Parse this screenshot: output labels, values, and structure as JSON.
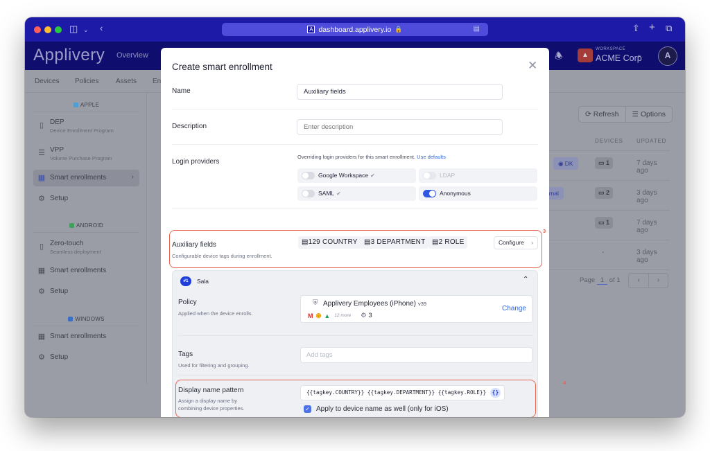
{
  "browser": {
    "url": "dashboard.applivery.io",
    "lock_icon": "lock-icon",
    "reader_icon": "reader-icon"
  },
  "header": {
    "brand": "Applivery",
    "nav": [
      "Overview"
    ],
    "workspace_label": "WORKSPACE",
    "workspace_name": "ACME Corp",
    "avatar_glyph": "A"
  },
  "subnav": [
    "Devices",
    "Policies",
    "Assets",
    "En"
  ],
  "sidebar": {
    "sections": [
      {
        "title": "APPLE",
        "color": "#4d9fd6",
        "items": [
          {
            "label": "DEP",
            "sub": "Device Enrollment Program",
            "icon": "phone-icon"
          },
          {
            "label": "VPP",
            "sub": "Volume Purchase Program",
            "icon": "layers-icon"
          },
          {
            "label": "Smart enrollments",
            "icon": "nodes-icon",
            "active": true
          },
          {
            "label": "Setup",
            "icon": "gear-icon"
          }
        ]
      },
      {
        "title": "ANDROID",
        "color": "#3fa05a",
        "items": [
          {
            "label": "Zero-touch",
            "sub": "Seamless deployment",
            "icon": "phone-icon"
          },
          {
            "label": "Smart enrollments",
            "icon": "nodes-icon"
          },
          {
            "label": "Setup",
            "icon": "gear-icon"
          }
        ]
      },
      {
        "title": "WINDOWS",
        "color": "#3a6fc7",
        "items": [
          {
            "label": "Smart enrollments",
            "icon": "nodes-icon"
          },
          {
            "label": "Setup",
            "icon": "gear-icon"
          }
        ]
      }
    ]
  },
  "background_table": {
    "refresh_label": "Refresh",
    "options_label": "Options",
    "columns": [
      "DEVICES",
      "UPDATED"
    ],
    "rows": [
      {
        "tag": "DK",
        "devices": "1",
        "updated": "7 days ago"
      },
      {
        "tag": "ernal",
        "devices": "2",
        "updated": "3 days ago"
      },
      {
        "tag": "",
        "devices": "1",
        "updated": "7 days ago"
      },
      {
        "tag": "",
        "devices": "-",
        "updated": "3 days ago"
      }
    ],
    "pager": {
      "prefix": "Page",
      "current": "1",
      "suffix": "of 1"
    }
  },
  "modal": {
    "title": "Create smart enrollment",
    "name_label": "Name",
    "name_value": "Auxiliary fields",
    "description_label": "Description",
    "description_placeholder": "Enter description",
    "login_label": "Login providers",
    "login_note": "Overriding login providers for this smart enrollment.",
    "login_defaults_link": "Use defaults",
    "providers": [
      {
        "name": "Google Workspace",
        "enabled": false,
        "verified": true,
        "disabled": false
      },
      {
        "name": "LDAP",
        "enabled": false,
        "verified": false,
        "disabled": true
      },
      {
        "name": "SAML",
        "enabled": false,
        "verified": true,
        "disabled": false
      },
      {
        "name": "Anonymous",
        "enabled": true,
        "verified": false,
        "disabled": false
      }
    ],
    "aux": {
      "label": "Auxiliary fields",
      "sub": "Configurable device tags during enrollment.",
      "chips": [
        {
          "count": "129",
          "key": "COUNTRY"
        },
        {
          "count": "3",
          "key": "DEPARTMENT"
        },
        {
          "count": "2",
          "key": "ROLE"
        }
      ],
      "configure_label": "Configure",
      "annotation": "3"
    },
    "rule": {
      "badge": "#1",
      "name": "Sala",
      "policy_label": "Policy",
      "policy_sub": "Applied when the device enrolls.",
      "policy_name": "Applivery Employees (iPhone)",
      "policy_version": "v39",
      "apps_more": "12 more",
      "config_count": "3",
      "change_label": "Change",
      "tags_label": "Tags",
      "tags_sub": "Used for filtering and grouping.",
      "tags_placeholder": "Add tags",
      "pattern_label": "Display name pattern",
      "pattern_sub_1": "Assign a display name by",
      "pattern_sub_2": "combining device properties.",
      "pattern_value": "{{tagkey.COUNTRY}} {{tagkey.DEPARTMENT}} {{tagkey.ROLE}}",
      "pattern_var_glyph": "{}",
      "apply_label": "Apply to device name as well (only for iOS)",
      "apply_checked": true,
      "annotation": "4"
    }
  },
  "colors": {
    "accent": "#1f3ddb",
    "link": "#2f63e0",
    "highlight": "#e8634f",
    "toolbar": "#1d1aa8"
  }
}
